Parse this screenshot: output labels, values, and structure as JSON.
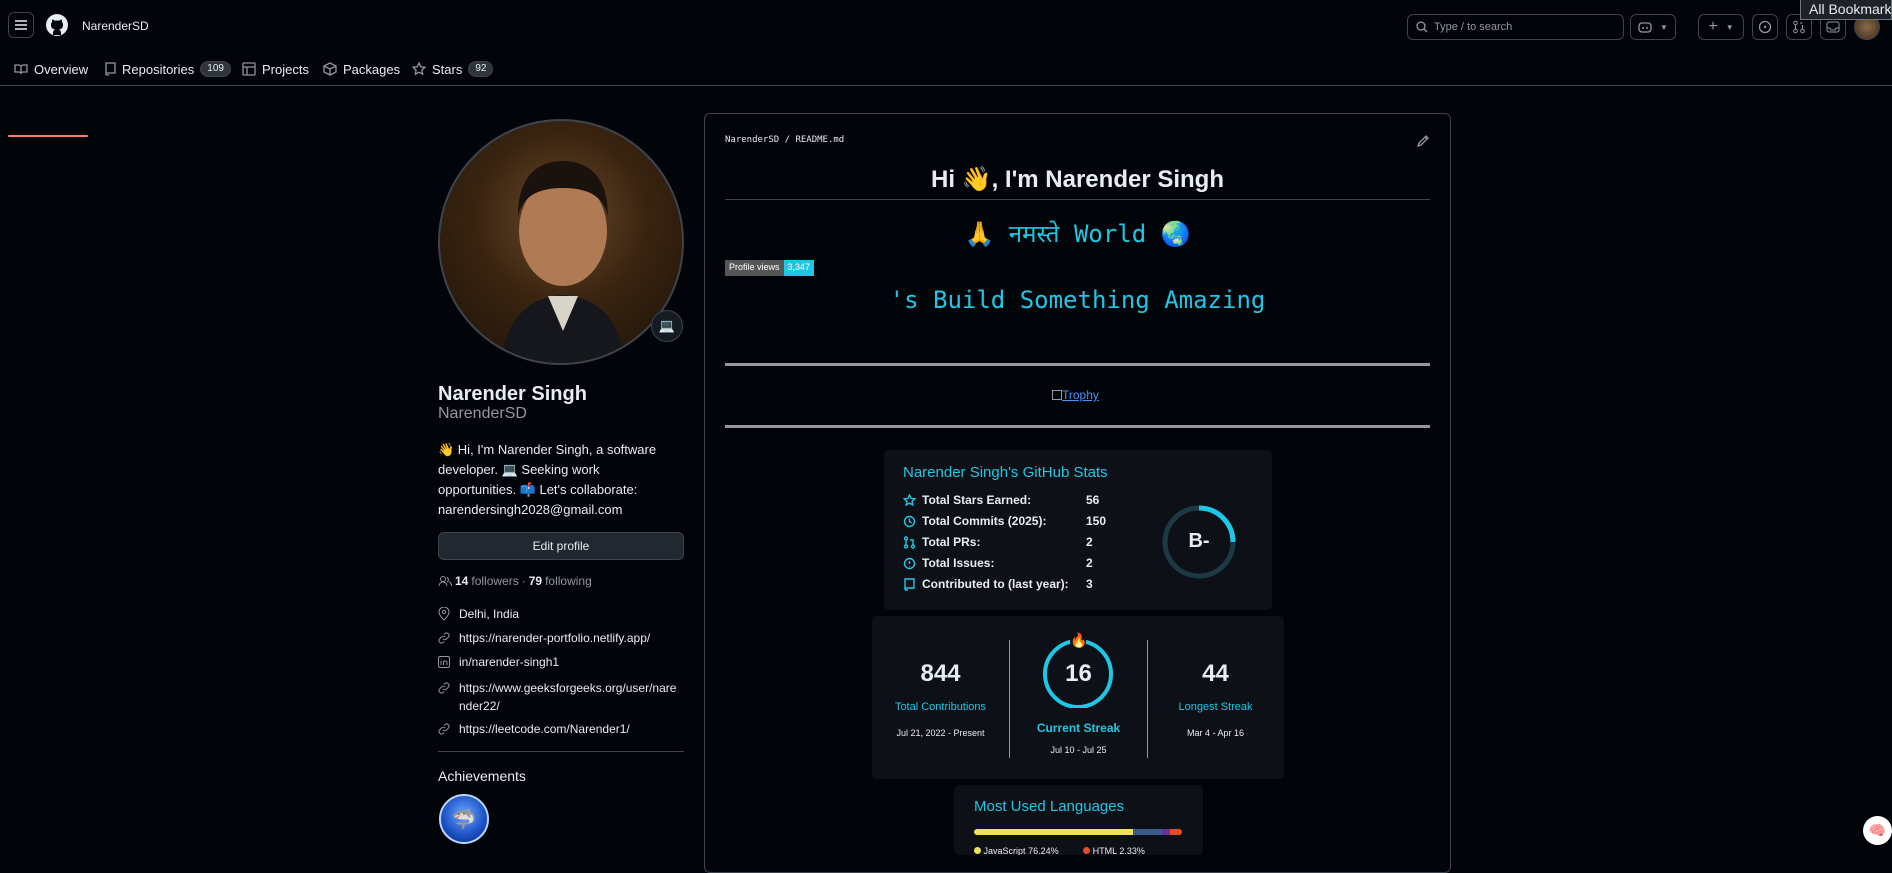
{
  "header": {
    "username": "NarenderSD",
    "search_placeholder": "Type / to search",
    "bookmarks_label": "All Bookmarks"
  },
  "tabs": [
    {
      "label": "Overview"
    },
    {
      "label": "Repositories",
      "count": "109"
    },
    {
      "label": "Projects"
    },
    {
      "label": "Packages"
    },
    {
      "label": "Stars",
      "count": "92"
    }
  ],
  "profile": {
    "name": "Narender Singh",
    "login": "NarenderSD",
    "bio": "👋 Hi, I'm Narender Singh, a software developer. 💻 Seeking work opportunities. 📫 Let's collaborate: narendersingh2028@gmail.com",
    "edit_label": "Edit profile",
    "followers": "14",
    "followers_label": "followers",
    "following": "79",
    "following_label": "following",
    "location": "Delhi, India",
    "website": "https://narender-portfolio.netlify.app/",
    "linkedin": "in/narender-singh1",
    "gfg": "https://www.geeksforgeeks.org/user/narender22/",
    "leetcode": "https://leetcode.com/Narender1/",
    "achievements_label": "Achievements"
  },
  "readme": {
    "path": "NarenderSD / README.md",
    "title": "Hi 👋, I'm Narender Singh",
    "namaste": "🙏 नमस्ते World 🌏",
    "views_label": "Profile views",
    "views_value": "3,347",
    "typing": "'s Build Something Amazing",
    "trophy_alt": "Trophy"
  },
  "stats": {
    "title": "Narender Singh's GitHub Stats",
    "rows": [
      {
        "label": "Total Stars Earned:",
        "value": "56",
        "icon": "star-icon"
      },
      {
        "label": "Total Commits (2025):",
        "value": "150",
        "icon": "history-icon"
      },
      {
        "label": "Total PRs:",
        "value": "2",
        "icon": "pr-icon"
      },
      {
        "label": "Total Issues:",
        "value": "2",
        "icon": "issue-icon"
      },
      {
        "label": "Contributed to (last year):",
        "value": "3",
        "icon": "repo-icon"
      }
    ],
    "grade": "B-"
  },
  "streak": {
    "total": "844",
    "total_label": "Total Contributions",
    "total_range": "Jul 21, 2022 - Present",
    "current": "16",
    "current_label": "Current Streak",
    "current_range": "Jul 10 - Jul 25",
    "longest": "44",
    "longest_label": "Longest Streak",
    "longest_range": "Mar 4 - Apr 16"
  },
  "languages": {
    "title": "Most Used Languages",
    "items": [
      {
        "name": "JavaScript",
        "value": "76.24%"
      },
      {
        "name": "HTML",
        "value": "2.33%"
      }
    ]
  },
  "colors": {
    "accent": "#1fc7e6",
    "bg": "#010409",
    "card": "#0d1117",
    "border": "#3d444d"
  }
}
